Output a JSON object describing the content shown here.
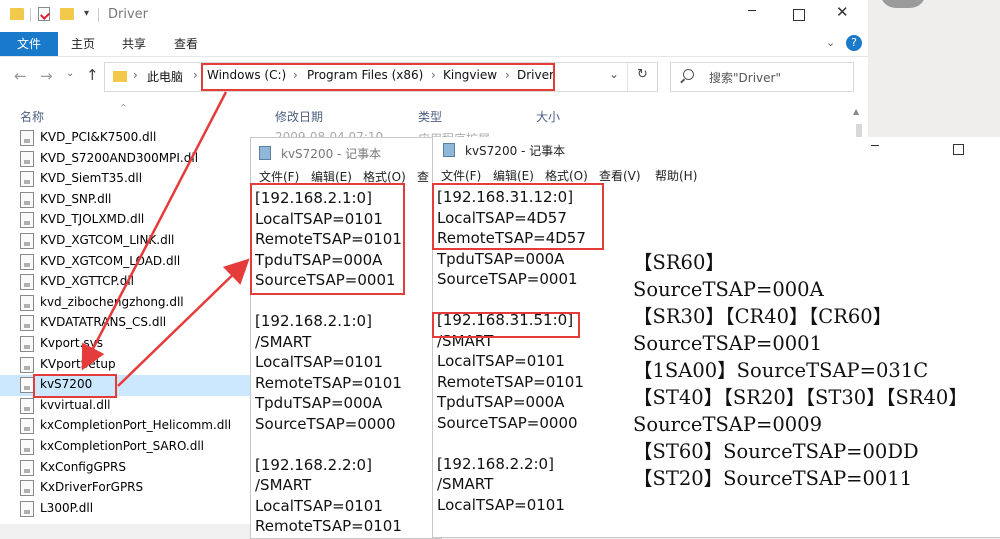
{
  "explorer": {
    "title": "Driver",
    "tabs": [
      "文件",
      "主页",
      "共享",
      "查看"
    ],
    "path": [
      "此电脑",
      "Windows (C:)",
      "Program Files (x86)",
      "Kingview",
      "Driver"
    ],
    "search_placeholder": "搜索\"Driver\"",
    "columns": [
      "名称",
      "修改日期",
      "类型",
      "大小"
    ],
    "files": [
      "KVD_PCI&K7500.dll",
      "KVD_S7200AND300MPI.dll",
      "KVD_SiemT35.dll",
      "KVD_SNP.dll",
      "KVD_TJOLXMD.dll",
      "KVD_XGTCOM_LINK.dll",
      "KVD_XGTCOM_LOAD.dll",
      "KVD_XGTTCP.dll",
      "kvd_zibochengzhong.dll",
      "KVDATATRANS_CS.dll",
      "Kvport.sys",
      "KVportSetup",
      "kvS7200",
      "kvvirtual.dll",
      "kxCompletionPort_Helicomm.dll",
      "kxCompletionPort_SARO.dll",
      "KxConfigGPRS",
      "KxDriverForGPRS",
      "L300P.dll"
    ],
    "selected_file": "kvS7200",
    "partial_date": "2009-08-04 07:10",
    "partial_type": "应用程序扩展"
  },
  "notepad1": {
    "title": "kvS7200 - 记事本",
    "menu": [
      "文件(F)",
      "编辑(E)",
      "格式(O)",
      "查"
    ],
    "lines": [
      "[192.168.2.1:0]",
      "LocalTSAP=0101",
      "RemoteTSAP=0101",
      "TpduTSAP=000A",
      "SourceTSAP=0001",
      "",
      "[192.168.2.1:0]",
      "/SMART",
      "LocalTSAP=0101",
      "RemoteTSAP=0101",
      "TpduTSAP=000A",
      "SourceTSAP=0000",
      "",
      "[192.168.2.2:0]",
      "/SMART",
      "LocalTSAP=0101",
      "RemoteTSAP=0101"
    ]
  },
  "notepad2": {
    "title": "kvS7200 - 记事本",
    "menu": [
      "文件(F)",
      "编辑(E)",
      "格式(O)",
      "查看(V)",
      "帮助(H)"
    ],
    "lines": [
      "[192.168.31.12:0]",
      "LocalTSAP=4D57",
      "RemoteTSAP=4D57",
      "TpduTSAP=000A",
      "SourceTSAP=0001",
      "",
      "[192.168.31.51:0]",
      "/SMART",
      "LocalTSAP=0101",
      "RemoteTSAP=0101",
      "TpduTSAP=000A",
      "SourceTSAP=0000",
      "",
      "[192.168.2.2:0]",
      "/SMART",
      "LocalTSAP=0101"
    ],
    "notes": [
      "【SR60】",
      "SourceTSAP=000A",
      "【SR30】【CR40】【CR60】",
      "SourceTSAP=0001",
      "【1SA00】SourceTSAP=031C",
      "【ST40】【SR20】【ST30】【SR40】",
      "SourceTSAP=0009",
      "【ST60】SourceTSAP=00DD",
      "【ST20】SourceTSAP=0011"
    ]
  },
  "colors": {
    "highlight": "#e63b3b",
    "ribbon_file": "#1979ca",
    "selected": "#cce8ff"
  }
}
